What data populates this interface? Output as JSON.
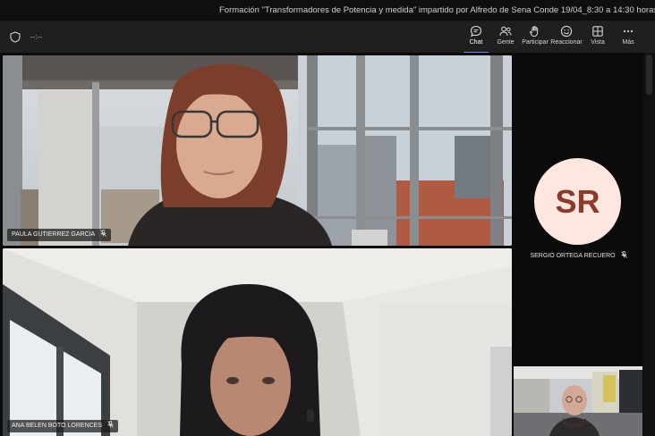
{
  "window": {
    "title": "Formación \"Transformadores de Potencia y medida\" impartido por Alfredo de Sena Conde 19/04_8:30 a 14:30 horas"
  },
  "toolbar": {
    "timer": "--:--",
    "buttons": [
      {
        "label": "Chat",
        "icon": "chat-icon",
        "active": true
      },
      {
        "label": "Gente",
        "icon": "people-icon"
      },
      {
        "label": "Participar",
        "icon": "raise-hand-icon"
      },
      {
        "label": "Reaccionar",
        "icon": "emoji-icon"
      },
      {
        "label": "Vista",
        "icon": "grid-view-icon"
      },
      {
        "label": "Más",
        "icon": "more-icon"
      }
    ]
  },
  "participants": {
    "tile1": {
      "name": "PAULA GUTIERREZ GARCIA"
    },
    "tile2": {
      "name": "ANA BELEN BOTO LORENCES"
    },
    "audio_only": {
      "initials": "SR",
      "name": "SERGIO ORTEGA RECUERO",
      "avatar_color": "#fde7de"
    }
  },
  "colors": {
    "accent": "#7f85f5",
    "toolbar": "#1f1f1f",
    "background": "#0b0b0b"
  }
}
